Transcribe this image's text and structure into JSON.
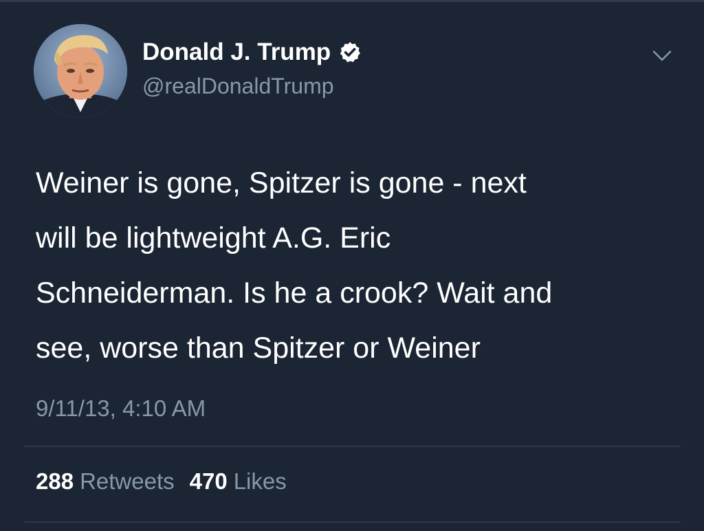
{
  "author": {
    "display_name": "Donald J. Trump",
    "handle": "@realDonaldTrump",
    "verified": true,
    "avatar_icon": "profile-photo"
  },
  "tweet": {
    "text": "Weiner is gone, Spitzer is gone - next\nwill be lightweight A.G. Eric\nSchneiderman. Is he a crook? Wait and\nsee, worse than Spitzer or Weiner",
    "timestamp": "9/11/13, 4:10 AM"
  },
  "stats": {
    "retweets_count": "288",
    "retweets_label": "Retweets",
    "likes_count": "470",
    "likes_label": "Likes"
  },
  "icons": {
    "menu": "chevron-down-icon",
    "verified": "verified-badge-icon"
  },
  "colors": {
    "background": "#1b2533",
    "primary_text": "#ffffff",
    "secondary_text": "#8899a6",
    "divider": "#2e3a48",
    "verified_badge": "#ffffff"
  }
}
